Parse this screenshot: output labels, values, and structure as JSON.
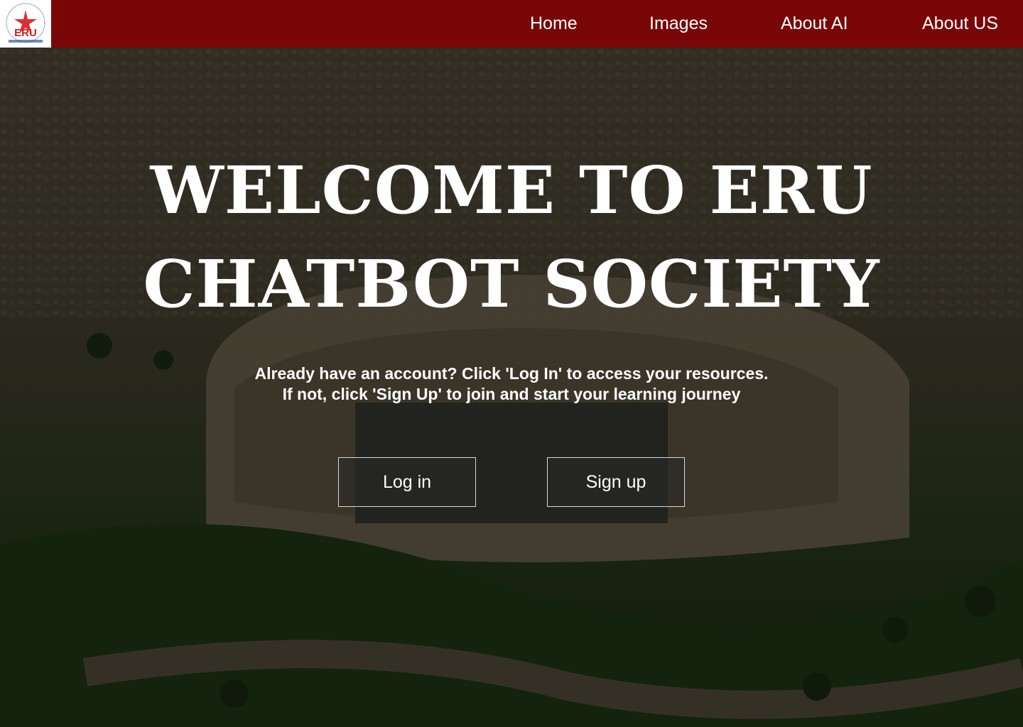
{
  "nav": {
    "logo_text": "ERU",
    "logo_caption": "Egyptian Russian University",
    "items": [
      {
        "label": "Home"
      },
      {
        "label": "Images"
      },
      {
        "label": "About AI"
      },
      {
        "label": "About US"
      }
    ]
  },
  "hero": {
    "title_line_1": "Welcome to ERU",
    "title_line_2": "Chatbot Society",
    "subtitle_line_1": "Already have an account? Click 'Log In' to access your resources.",
    "subtitle_line_2": "If not, click 'Sign Up' to join and start your learning journey",
    "login_label": "Log in",
    "signup_label": "Sign up",
    "background": "aerial-campus-photo"
  },
  "colors": {
    "nav_bg": "#7a0707",
    "text": "#ffffff",
    "logo_red": "#d41d1d",
    "logo_blue": "#1b3a8c"
  }
}
